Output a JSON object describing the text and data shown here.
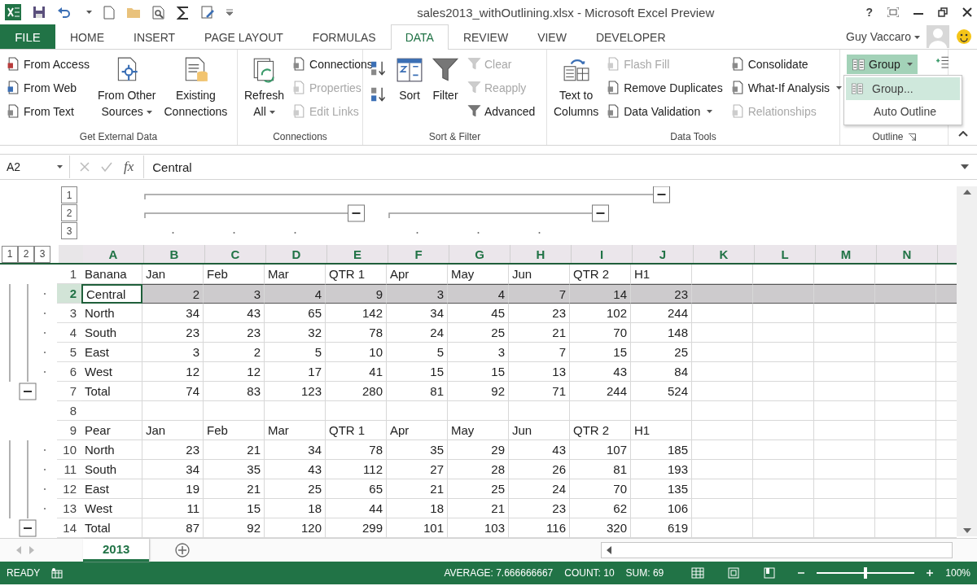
{
  "title_bar": {
    "title": "sales2013_withOutlining.xlsx - Microsoft Excel Preview",
    "help": "?"
  },
  "file_tab": "FILE",
  "tabs": [
    {
      "label": "HOME",
      "selected": false
    },
    {
      "label": "INSERT",
      "selected": false
    },
    {
      "label": "PAGE LAYOUT",
      "selected": false
    },
    {
      "label": "FORMULAS",
      "selected": false
    },
    {
      "label": "DATA",
      "selected": true
    },
    {
      "label": "REVIEW",
      "selected": false
    },
    {
      "label": "VIEW",
      "selected": false
    },
    {
      "label": "DEVELOPER",
      "selected": false
    }
  ],
  "user": {
    "name": "Guy Vaccaro"
  },
  "ribbon_groups": [
    {
      "label": "Get External Data",
      "columns": [
        {
          "kind": "stack",
          "items": [
            {
              "label": "From Access",
              "disabled": false
            },
            {
              "label": "From Web",
              "disabled": false
            },
            {
              "label": "From Text",
              "disabled": false
            }
          ]
        },
        {
          "kind": "large",
          "lines": [
            "From Other",
            "Sources"
          ],
          "dropdown": true
        },
        {
          "kind": "large",
          "lines": [
            "Existing",
            "Connections"
          ],
          "dropdown": false
        }
      ]
    },
    {
      "label": "Connections",
      "columns": [
        {
          "kind": "large",
          "lines": [
            "Refresh",
            "All"
          ],
          "dropdown": true
        },
        {
          "kind": "stack",
          "items": [
            {
              "label": "Connections",
              "disabled": false
            },
            {
              "label": "Properties",
              "disabled": true
            },
            {
              "label": "Edit Links",
              "disabled": true
            }
          ]
        }
      ]
    },
    {
      "label": "Sort & Filter",
      "columns": [
        {
          "kind": "sort_icons"
        },
        {
          "kind": "large",
          "lines": [
            "Sort"
          ],
          "dropdown": false
        },
        {
          "kind": "large",
          "lines": [
            "Filter"
          ],
          "dropdown": false
        },
        {
          "kind": "stack",
          "items": [
            {
              "label": "Clear",
              "disabled": true
            },
            {
              "label": "Reapply",
              "disabled": true
            },
            {
              "label": "Advanced",
              "disabled": false
            }
          ]
        }
      ]
    },
    {
      "label": "Data Tools",
      "columns": [
        {
          "kind": "large",
          "lines": [
            "Text to",
            "Columns"
          ],
          "dropdown": false
        },
        {
          "kind": "stack",
          "items": [
            {
              "label": "Flash Fill",
              "disabled": true
            },
            {
              "label": "Remove Duplicates",
              "disabled": false
            },
            {
              "label": "Data Validation",
              "disabled": false,
              "dropdown": true
            }
          ]
        },
        {
          "kind": "stack",
          "items": [
            {
              "label": "Consolidate",
              "disabled": false
            },
            {
              "label": "What-If Analysis",
              "disabled": false,
              "dropdown": true
            },
            {
              "label": "Relationships",
              "disabled": true
            }
          ]
        }
      ]
    },
    {
      "label": "Outline",
      "columns": [
        {
          "kind": "group_button",
          "label": "Group",
          "selected": true
        }
      ]
    }
  ],
  "outline_menu": {
    "items": [
      {
        "label": "Group...",
        "selected": true
      },
      {
        "label": "Auto Outline",
        "selected": false
      }
    ]
  },
  "formula_bar": {
    "name_box": "A2",
    "fx": "fx",
    "value": "Central"
  },
  "outline_levels": {
    "columns": [
      "1",
      "2",
      "3"
    ],
    "rows": [
      "1",
      "2",
      "3"
    ]
  },
  "columns": [
    {
      "letter": "A",
      "kind": "plain"
    },
    {
      "letter": "B",
      "kind": "grouped"
    },
    {
      "letter": "C",
      "kind": "grouped"
    },
    {
      "letter": "D",
      "kind": "grouped"
    },
    {
      "letter": "E",
      "kind": "subtotal"
    },
    {
      "letter": "F",
      "kind": "grouped"
    },
    {
      "letter": "G",
      "kind": "grouped"
    },
    {
      "letter": "H",
      "kind": "grouped"
    },
    {
      "letter": "I",
      "kind": "subtotal"
    },
    {
      "letter": "J",
      "kind": "total"
    },
    {
      "letter": "K",
      "kind": "plain"
    },
    {
      "letter": "L",
      "kind": "plain"
    },
    {
      "letter": "M",
      "kind": "plain"
    },
    {
      "letter": "N",
      "kind": "plain"
    }
  ],
  "rows": [
    {
      "num": "1",
      "kind": "header",
      "selected": false,
      "cells": [
        "Banana",
        "Jan",
        "Feb",
        "Mar",
        "QTR 1",
        "Apr",
        "May",
        "Jun",
        "QTR 2",
        "H1"
      ]
    },
    {
      "num": "2",
      "kind": "data",
      "selected": true,
      "grouped": true,
      "cells": [
        "Central",
        "2",
        "3",
        "4",
        "9",
        "3",
        "4",
        "7",
        "14",
        "23"
      ]
    },
    {
      "num": "3",
      "kind": "data",
      "selected": false,
      "grouped": true,
      "cells": [
        "North",
        "34",
        "43",
        "65",
        "142",
        "34",
        "45",
        "23",
        "102",
        "244"
      ]
    },
    {
      "num": "4",
      "kind": "data",
      "selected": false,
      "grouped": true,
      "cells": [
        "South",
        "23",
        "23",
        "32",
        "78",
        "24",
        "25",
        "21",
        "70",
        "148"
      ]
    },
    {
      "num": "5",
      "kind": "data",
      "selected": false,
      "grouped": true,
      "cells": [
        "East",
        "3",
        "2",
        "5",
        "10",
        "5",
        "3",
        "7",
        "15",
        "25"
      ]
    },
    {
      "num": "6",
      "kind": "data",
      "selected": false,
      "grouped": true,
      "cells": [
        "West",
        "12",
        "12",
        "17",
        "41",
        "15",
        "15",
        "13",
        "43",
        "84"
      ]
    },
    {
      "num": "7",
      "kind": "data",
      "selected": false,
      "collapse": true,
      "cells": [
        "Total",
        "74",
        "83",
        "123",
        "280",
        "81",
        "92",
        "71",
        "244",
        "524"
      ]
    },
    {
      "num": "8",
      "kind": "blank",
      "selected": false
    },
    {
      "num": "9",
      "kind": "header",
      "selected": false,
      "cells": [
        "Pear",
        "Jan",
        "Feb",
        "Mar",
        "QTR 1",
        "Apr",
        "May",
        "Jun",
        "QTR 2",
        "H1"
      ]
    },
    {
      "num": "10",
      "kind": "data",
      "selected": false,
      "grouped": true,
      "cells": [
        "North",
        "23",
        "21",
        "34",
        "78",
        "35",
        "29",
        "43",
        "107",
        "185"
      ]
    },
    {
      "num": "11",
      "kind": "data",
      "selected": false,
      "grouped": true,
      "cells": [
        "South",
        "34",
        "35",
        "43",
        "112",
        "27",
        "28",
        "26",
        "81",
        "193"
      ]
    },
    {
      "num": "12",
      "kind": "data",
      "selected": false,
      "grouped": true,
      "cells": [
        "East",
        "19",
        "21",
        "25",
        "65",
        "21",
        "25",
        "24",
        "70",
        "135"
      ]
    },
    {
      "num": "13",
      "kind": "data",
      "selected": false,
      "grouped": true,
      "cells": [
        "West",
        "11",
        "15",
        "18",
        "44",
        "18",
        "21",
        "23",
        "62",
        "106"
      ]
    },
    {
      "num": "14",
      "kind": "data",
      "selected": false,
      "collapse": true,
      "cells": [
        "Total",
        "87",
        "92",
        "120",
        "299",
        "101",
        "103",
        "116",
        "320",
        "619"
      ]
    }
  ],
  "sheet_tabs": [
    {
      "label": "2013",
      "selected": true
    }
  ],
  "status_bar": {
    "mode": "READY",
    "average": "AVERAGE: 7.666666667",
    "count": "COUNT: 10",
    "sum": "SUM: 69",
    "zoom": "100%",
    "level": 0.5
  }
}
